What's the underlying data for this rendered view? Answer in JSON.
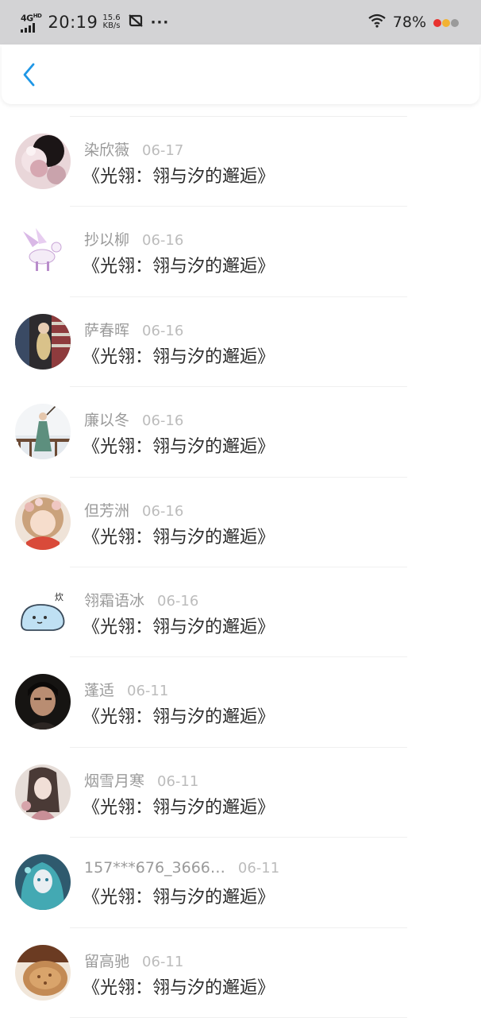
{
  "status_bar": {
    "network": "4G",
    "network_sup": "HD",
    "time": "20:19",
    "speed_value": "15.6",
    "speed_unit": "KB/s",
    "more": "···",
    "battery": "78%",
    "dot_colors": [
      "#e8322f",
      "#f2b233",
      "#9a9a9a"
    ]
  },
  "nav": {
    "back_icon": "chevron-left-icon",
    "accent": "#1f97e6"
  },
  "items": [
    {
      "name": "染欣薇",
      "date": "06-17",
      "title": "《光翎：翎与汐的邂逅》"
    },
    {
      "name": "抄以柳",
      "date": "06-16",
      "title": "《光翎：翎与汐的邂逅》"
    },
    {
      "name": "萨春晖",
      "date": "06-16",
      "title": "《光翎：翎与汐的邂逅》"
    },
    {
      "name": "廉以冬",
      "date": "06-16",
      "title": "《光翎：翎与汐的邂逅》"
    },
    {
      "name": "但芳洲",
      "date": "06-16",
      "title": "《光翎：翎与汐的邂逅》"
    },
    {
      "name": "翎霜语冰",
      "date": "06-16",
      "title": "《光翎：翎与汐的邂逅》"
    },
    {
      "name": "蓬适",
      "date": "06-11",
      "title": "《光翎：翎与汐的邂逅》"
    },
    {
      "name": "烟雪月寒",
      "date": "06-11",
      "title": "《光翎：翎与汐的邂逅》"
    },
    {
      "name": "157***676_3666…",
      "date": "06-11",
      "title": "《光翎：翎与汐的邂逅》"
    },
    {
      "name": "留高驰",
      "date": "06-11",
      "title": "《光翎：翎与汐的邂逅》"
    }
  ]
}
